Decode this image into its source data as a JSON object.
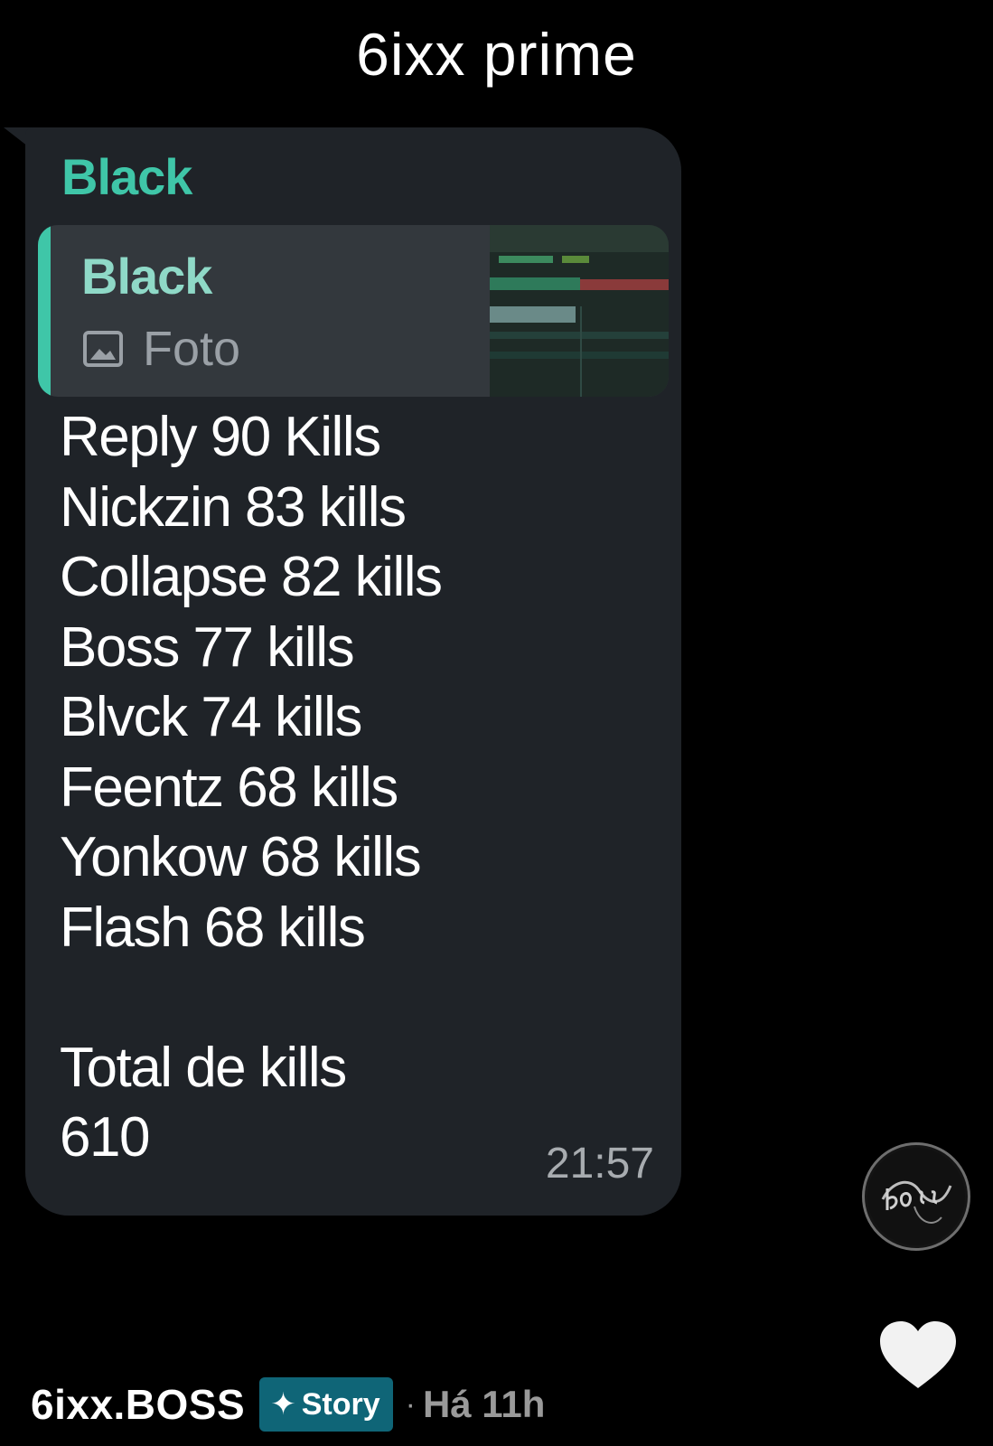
{
  "caption": "6ixx prime",
  "message": {
    "sender": "Black",
    "quote": {
      "author": "Black",
      "media_icon": "image-icon",
      "media_label": "Foto"
    },
    "lines": [
      "Reply 90 Kills",
      "Nickzin 83 kills",
      "Collapse 82 kills",
      "Boss 77 kills",
      "Blvck 74 kills",
      "Feentz 68 kills",
      "Yonkow 68 kills",
      "Flash 68 kills"
    ],
    "total_label": "Total de kills",
    "total_value": "610",
    "time": "21:57"
  },
  "footer": {
    "username": "6ixx.BOSS",
    "badge_icon": "sparkle-icon",
    "badge_label": "Story",
    "separator": "·",
    "time_ago": "Há 11h"
  },
  "colors": {
    "background": "#000000",
    "bubble": "#1f2328",
    "accent": "#3fc6a8",
    "quote_bg": "#33383d",
    "badge": "#0f6577"
  }
}
